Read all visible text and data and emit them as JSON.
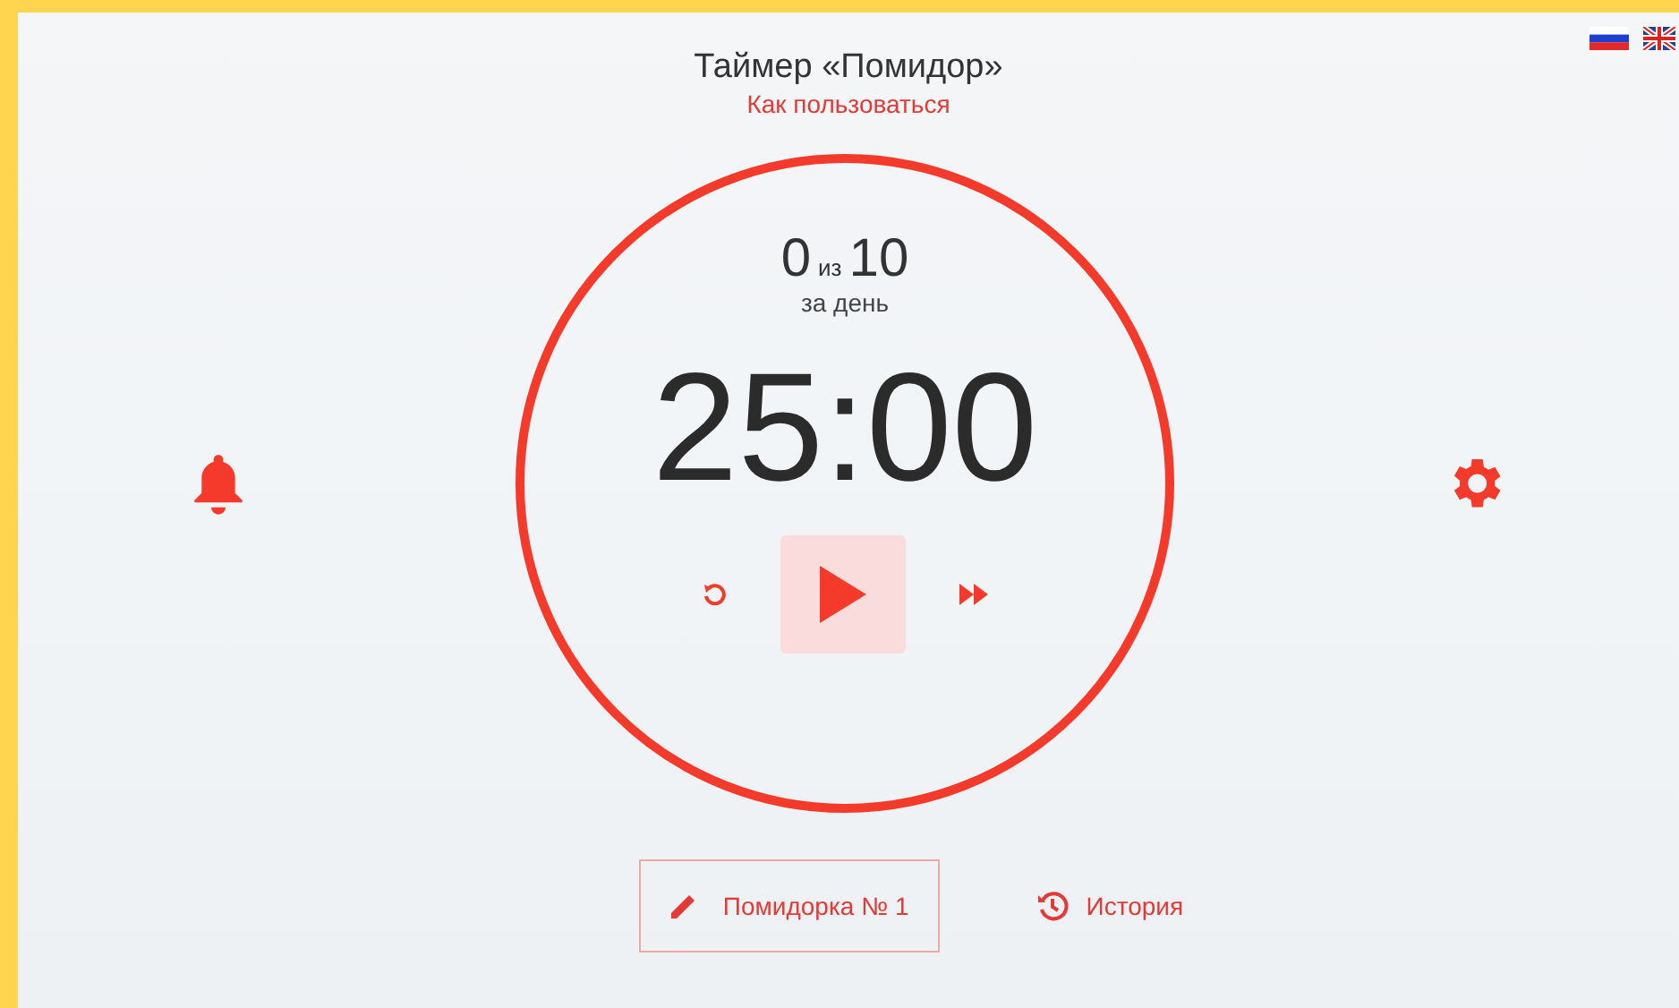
{
  "header": {
    "title": "Таймер «Помидор»",
    "help_link": "Как пользоваться"
  },
  "timer": {
    "done": "0",
    "of": "из",
    "goal": "10",
    "period": "за день",
    "time": "25:00",
    "running": false
  },
  "footer": {
    "task_button": "Помидорка № 1",
    "history_link": "История"
  }
}
